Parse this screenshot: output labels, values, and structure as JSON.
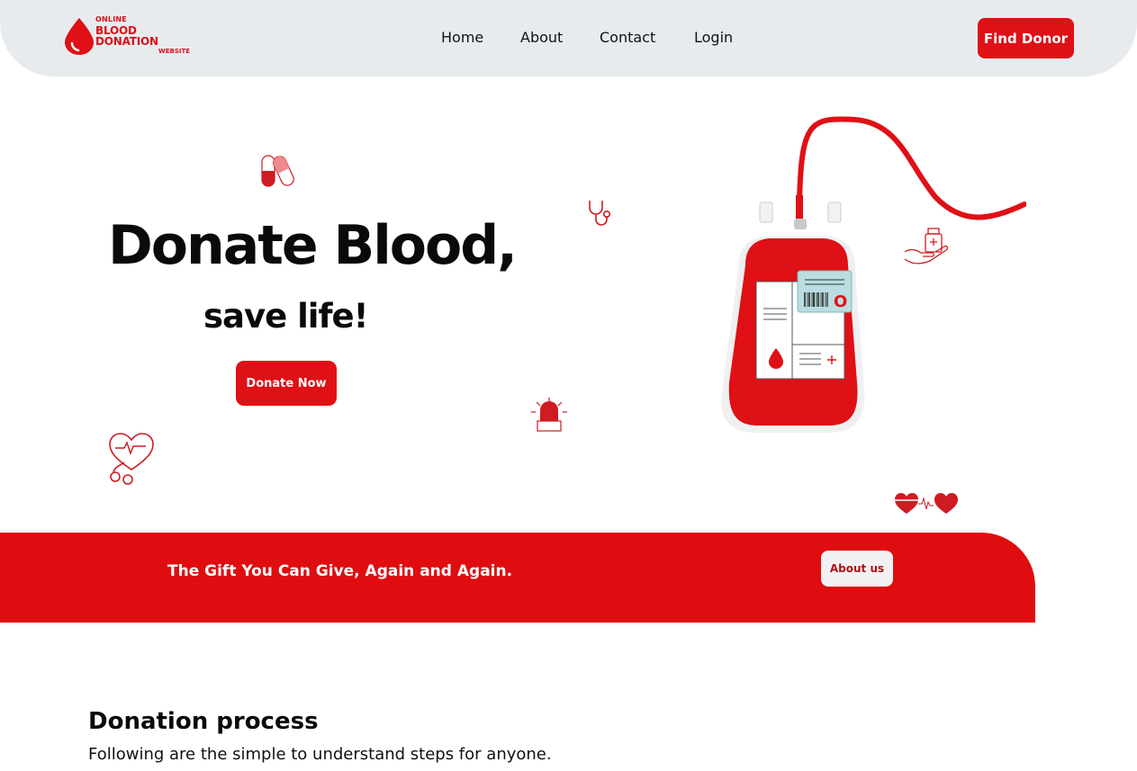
{
  "logo": {
    "line1": "ONLINE",
    "line2": "BLOOD DONATION",
    "line3": "WEBSITE"
  },
  "nav": {
    "items": [
      {
        "label": "Home"
      },
      {
        "label": "About"
      },
      {
        "label": "Contact"
      },
      {
        "label": "Login"
      }
    ],
    "cta_label": "Find Donor"
  },
  "hero": {
    "title": "Donate Blood,",
    "subtitle": "save life!",
    "cta_label": "Donate Now",
    "bag_label": "O"
  },
  "band": {
    "text": "The Gift You Can Give, Again and Again.",
    "button_label": "About us"
  },
  "process": {
    "title": "Donation process",
    "subtitle": "Following are the simple to understand steps for anyone."
  },
  "colors": {
    "brand_red": "#df1016",
    "header_bg": "#e8ebee"
  },
  "icons": [
    "blood-drop-icon",
    "pill-capsule-icon",
    "stethoscope-icon",
    "heart-stethoscope-icon",
    "siren-icon",
    "hand-medicine-icon",
    "heartbeat-hearts-icon",
    "blood-bag-illustration"
  ]
}
